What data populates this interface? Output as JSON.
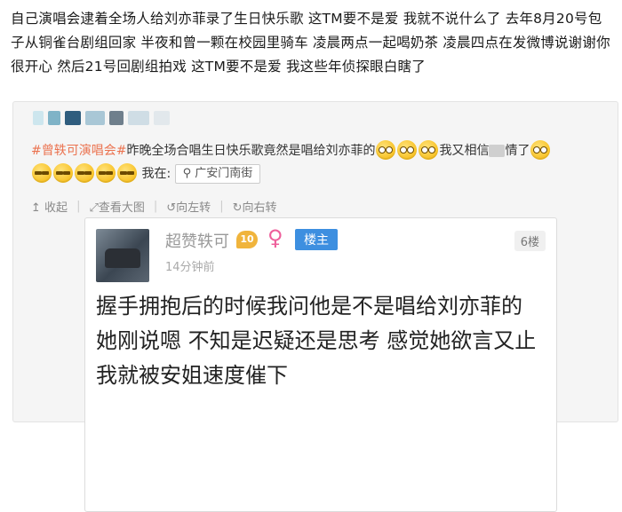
{
  "post": {
    "text": "自己演唱会逮着全场人给刘亦菲录了生日快乐歌 这TM要不是爱 我就不说什么了 去年8月20号包子从铜雀台剧组回家 半夜和曾一颗在校园里骑车 凌晨两点一起喝奶茶 凌晨四点在发微博说谢谢你 很开心 然后21号回剧组拍戏 这TM要不是爱 我这些年侦探眼白瞎了"
  },
  "repost": {
    "topic": "#曾轶可演唱会#",
    "text_before_emoji": "昨晚全场合唱生日快乐歌竟然是唱给刘亦菲的",
    "text_mid": "我又相信",
    "text_after_blur": "情了",
    "location_prefix": "我在:",
    "location_icon": "pin-icon",
    "location": "广安门南街",
    "actions": [
      "收起",
      "查看大图",
      "向左转",
      "向右转"
    ],
    "colors": {
      "topic": "#eb7350",
      "owner_badge": "#3d8fe0",
      "level_badge": "#f0b43c",
      "female": "#ee5f9b"
    }
  },
  "card": {
    "username": "超赞轶可",
    "level": "10",
    "gender_symbol": "♀",
    "owner_badge": "楼主",
    "floor": "6楼",
    "time": "14分钟前",
    "body": "握手拥抱后的时候我问他是不是唱给刘亦菲的 她刚说嗯 不知是迟疑还是思考 感觉她欲言又止 我就被安姐速度催下"
  }
}
